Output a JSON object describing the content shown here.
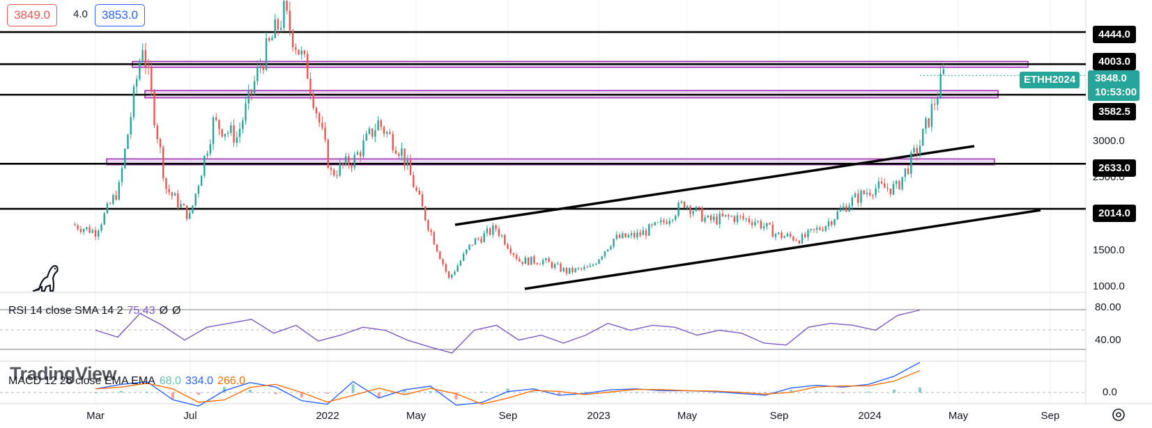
{
  "chart_data": {
    "type": "candlestick",
    "symbol": "ETHH2024",
    "quote": {
      "bid": "3849.0",
      "spread": "4.0",
      "ask": "3853.0"
    },
    "last_price": "3848.0",
    "countdown": "10:53:00",
    "price_ticks": [
      "3000.0",
      "2500.0",
      "1500.0",
      "1000.0"
    ],
    "level_tags": [
      "4444.0",
      "4003.0",
      "3582.5",
      "2633.0",
      "2014.0"
    ],
    "horizontal_lines": [
      4444,
      4003,
      3582.5,
      2633,
      2014
    ],
    "zones": [
      [
        3960,
        4040
      ],
      [
        3540,
        3640
      ],
      [
        2620,
        2700
      ]
    ],
    "x_labels": [
      "Mar",
      "Jul",
      "2022",
      "May",
      "Sep",
      "2023",
      "May",
      "Sep",
      "2024",
      "May",
      "Sep"
    ],
    "price_series": [
      [
        "2021-02",
        1800
      ],
      [
        "2021-03",
        1700
      ],
      [
        "2021-04",
        2300
      ],
      [
        "2021-05",
        4300
      ],
      [
        "2021-06",
        2300
      ],
      [
        "2021-07",
        1900
      ],
      [
        "2021-08",
        3200
      ],
      [
        "2021-09",
        3000
      ],
      [
        "2021-10",
        4000
      ],
      [
        "2021-11",
        4700
      ],
      [
        "2021-12",
        3900
      ],
      [
        "2022-01",
        2500
      ],
      [
        "2022-02",
        2700
      ],
      [
        "2022-03",
        3200
      ],
      [
        "2022-04",
        2800
      ],
      [
        "2022-05",
        1900
      ],
      [
        "2022-06",
        1050
      ],
      [
        "2022-07",
        1550
      ],
      [
        "2022-08",
        1750
      ],
      [
        "2022-09",
        1300
      ],
      [
        "2022-10",
        1300
      ],
      [
        "2022-11",
        1150
      ],
      [
        "2022-12",
        1200
      ],
      [
        "2023-01",
        1600
      ],
      [
        "2023-02",
        1650
      ],
      [
        "2023-03",
        1800
      ],
      [
        "2023-04",
        2100
      ],
      [
        "2023-05",
        1850
      ],
      [
        "2023-06",
        1900
      ],
      [
        "2023-07",
        1850
      ],
      [
        "2023-08",
        1650
      ],
      [
        "2023-09",
        1600
      ],
      [
        "2023-10",
        1800
      ],
      [
        "2023-11",
        2100
      ],
      [
        "2023-12",
        2300
      ],
      [
        "2024-01",
        2300
      ],
      [
        "2024-02",
        2900
      ],
      [
        "2024-03",
        3848
      ]
    ],
    "rsi": {
      "label": "RSI 14 close SMA 14 2",
      "value": "75.43",
      "extra": [
        "Ø",
        "Ø"
      ],
      "ticks": [
        "80.00",
        "40.00"
      ],
      "series": [
        55,
        48,
        72,
        60,
        45,
        58,
        62,
        66,
        52,
        60,
        44,
        50,
        58,
        55,
        45,
        38,
        32,
        55,
        60,
        45,
        50,
        42,
        50,
        62,
        55,
        60,
        58,
        50,
        55,
        52,
        42,
        40,
        58,
        62,
        60,
        55,
        70,
        75.43
      ]
    },
    "macd": {
      "label": "MACD 12 26 close EMA EMA",
      "values": [
        "68.0",
        "334.0",
        "266.0"
      ],
      "ticks": [
        "0.0"
      ],
      "series": [
        40,
        90,
        120,
        -80,
        -150,
        20,
        110,
        60,
        -90,
        -130,
        120,
        -60,
        30,
        70,
        -140,
        -110,
        10,
        40,
        -30,
        -10,
        30,
        40,
        20,
        20,
        10,
        -10,
        -30,
        50,
        80,
        60,
        90,
        180,
        334
      ]
    },
    "colors": {
      "up": "#26a69a",
      "down": "#ef5350",
      "accent": "#2962ff",
      "rsi": "#7e57c2",
      "macd_signal": "#ff6d00",
      "zone": "#9c27b0"
    }
  },
  "watermark": "TradingView",
  "icons": {
    "clock": "clock-settings-icon",
    "dino": "dino-icon"
  }
}
